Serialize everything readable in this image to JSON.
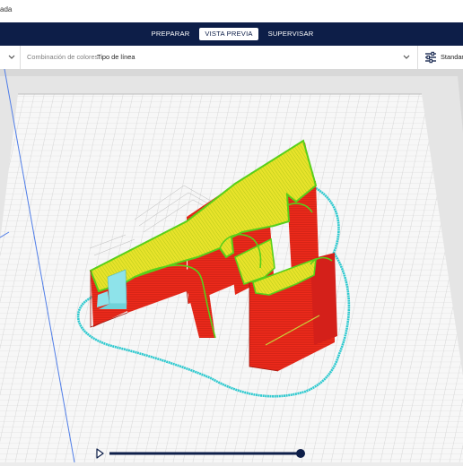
{
  "window": {
    "title_fragment": "ada"
  },
  "nav": {
    "tabs": [
      {
        "label": "PREPARAR",
        "active": false
      },
      {
        "label": "VISTA PREVIA",
        "active": true
      },
      {
        "label": "SUPERVISAR",
        "active": false
      }
    ]
  },
  "toolbar": {
    "color_scheme_label": "Combinación de colores",
    "color_scheme_value": "Tipo de línea",
    "profile_label": "Standard",
    "profile_icon": "sliders-icon",
    "expand_icon": "chevron-down-icon"
  },
  "colors": {
    "nav_bg": "#0d1e48",
    "wall_red": "#ee2a1b",
    "infill_yellow": "#e8e32a",
    "inner_wall_green": "#58d01a",
    "skirt_cyan": "#2ec9cf",
    "support_cyan": "#8ee3ea",
    "slider_navy": "#0d1e48"
  },
  "layer_slider": {
    "play_icon": "play-icon",
    "position_fraction": 1.0
  }
}
